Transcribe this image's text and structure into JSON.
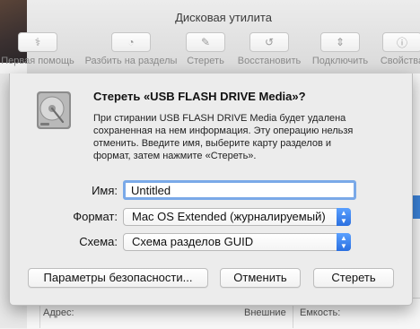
{
  "window": {
    "title": "Дисковая утилита"
  },
  "toolbar": {
    "items": [
      {
        "label": "Первая помощь",
        "icon": "stethoscope-icon",
        "glyph": "⚕"
      },
      {
        "label": "Разбить на разделы",
        "icon": "pie-partition-icon",
        "glyph": "◔"
      },
      {
        "label": "Стереть",
        "icon": "erase-icon",
        "glyph": "✎"
      },
      {
        "label": "Восстановить",
        "icon": "restore-icon",
        "glyph": "↺"
      },
      {
        "label": "Подключить",
        "icon": "mount-icon",
        "glyph": "⇕"
      },
      {
        "label": "Свойства",
        "icon": "info-icon",
        "glyph": "ⓘ"
      }
    ]
  },
  "dialog": {
    "title": "Стереть «USB FLASH DRIVE Media»?",
    "message": "При стирании USB FLASH DRIVE Media будет удалена сохраненная на нем информация. Эту операцию нельзя отменить. Введите имя, выберите карту разделов и формат, затем нажмите «Стереть».",
    "name_label": "Имя:",
    "name_value": "Untitled",
    "format_label": "Формат:",
    "format_value": "Mac OS Extended (журналируемый)",
    "scheme_label": "Схема:",
    "scheme_value": "Схема разделов GUID",
    "security_button": "Параметры безопасности...",
    "cancel_button": "Отменить",
    "erase_button": "Стереть"
  },
  "info": {
    "address_label": "Адрес:",
    "external_value": "Внешние",
    "capacity_label": "Емкость:"
  },
  "colors": {
    "accent": "#3b82d8",
    "focus_ring": "#7aa9e8"
  }
}
